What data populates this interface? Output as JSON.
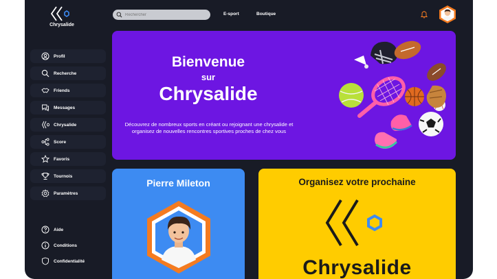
{
  "app": {
    "name": "Chrysalide"
  },
  "search": {
    "placeholder": "Rechercher"
  },
  "topnav": {
    "esport": "E-sport",
    "boutique": "Boutique"
  },
  "sidebar": {
    "items": [
      {
        "label": "Profil",
        "icon": "user-icon"
      },
      {
        "label": "Recherche",
        "icon": "search-icon"
      },
      {
        "label": "Friends",
        "icon": "handshake-icon"
      },
      {
        "label": "Messages",
        "icon": "chat-icon"
      },
      {
        "label": "Chrysalide",
        "icon": "chrysalide-icon"
      },
      {
        "label": "Score",
        "icon": "network-icon"
      },
      {
        "label": "Favoris",
        "icon": "star-icon"
      },
      {
        "label": "Tournois",
        "icon": "trophy-icon"
      },
      {
        "label": "Paramètres",
        "icon": "gear-icon"
      }
    ],
    "bottom": [
      {
        "label": "Aide",
        "icon": "help-icon"
      },
      {
        "label": "Conditions",
        "icon": "info-icon"
      },
      {
        "label": "Confidentialité",
        "icon": "shield-icon"
      }
    ]
  },
  "hero": {
    "line1": "Bienvenue",
    "line2": "sur",
    "line3": "Chrysalide",
    "description": "Découvrez de nombreux sports en créant ou rejoignant une chrysalide et organisez de nouvelles rencontres sportives proches de chez vous"
  },
  "profile_card": {
    "name": "Pierre Mileton"
  },
  "organize_card": {
    "title": "Organisez votre prochaine",
    "brand": "Chrysalide"
  },
  "colors": {
    "background": "#181b26",
    "hero": "#6d16e2",
    "profile_card": "#3d8bf2",
    "organize_card": "#ffcc00",
    "accent": "#f47b20"
  }
}
